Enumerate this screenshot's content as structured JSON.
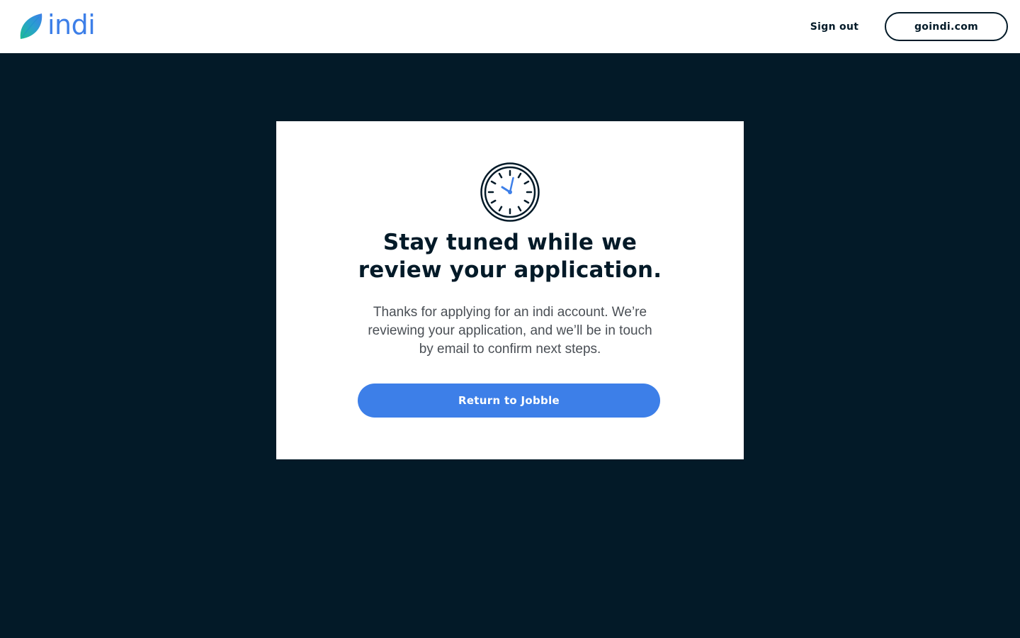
{
  "header": {
    "logo_text": "indi",
    "logo_icon": "leaf-icon",
    "sign_out_label": "Sign out",
    "site_link_label": "goindi.com"
  },
  "card": {
    "icon": "clock-icon",
    "headline_line1": "Stay tuned while we",
    "headline_line2": "review your application.",
    "body": "Thanks for applying for an indi account. We’re reviewing your application, and we’ll be in touch by email to confirm next steps.",
    "cta_label": "Return to Jobble"
  },
  "colors": {
    "page_background": "#031a28",
    "card_background": "#ffffff",
    "brand_blue": "#3d7fe8",
    "brand_green": "#1fbf8f",
    "text_dark": "#031a28",
    "text_body": "#4a4f55"
  }
}
